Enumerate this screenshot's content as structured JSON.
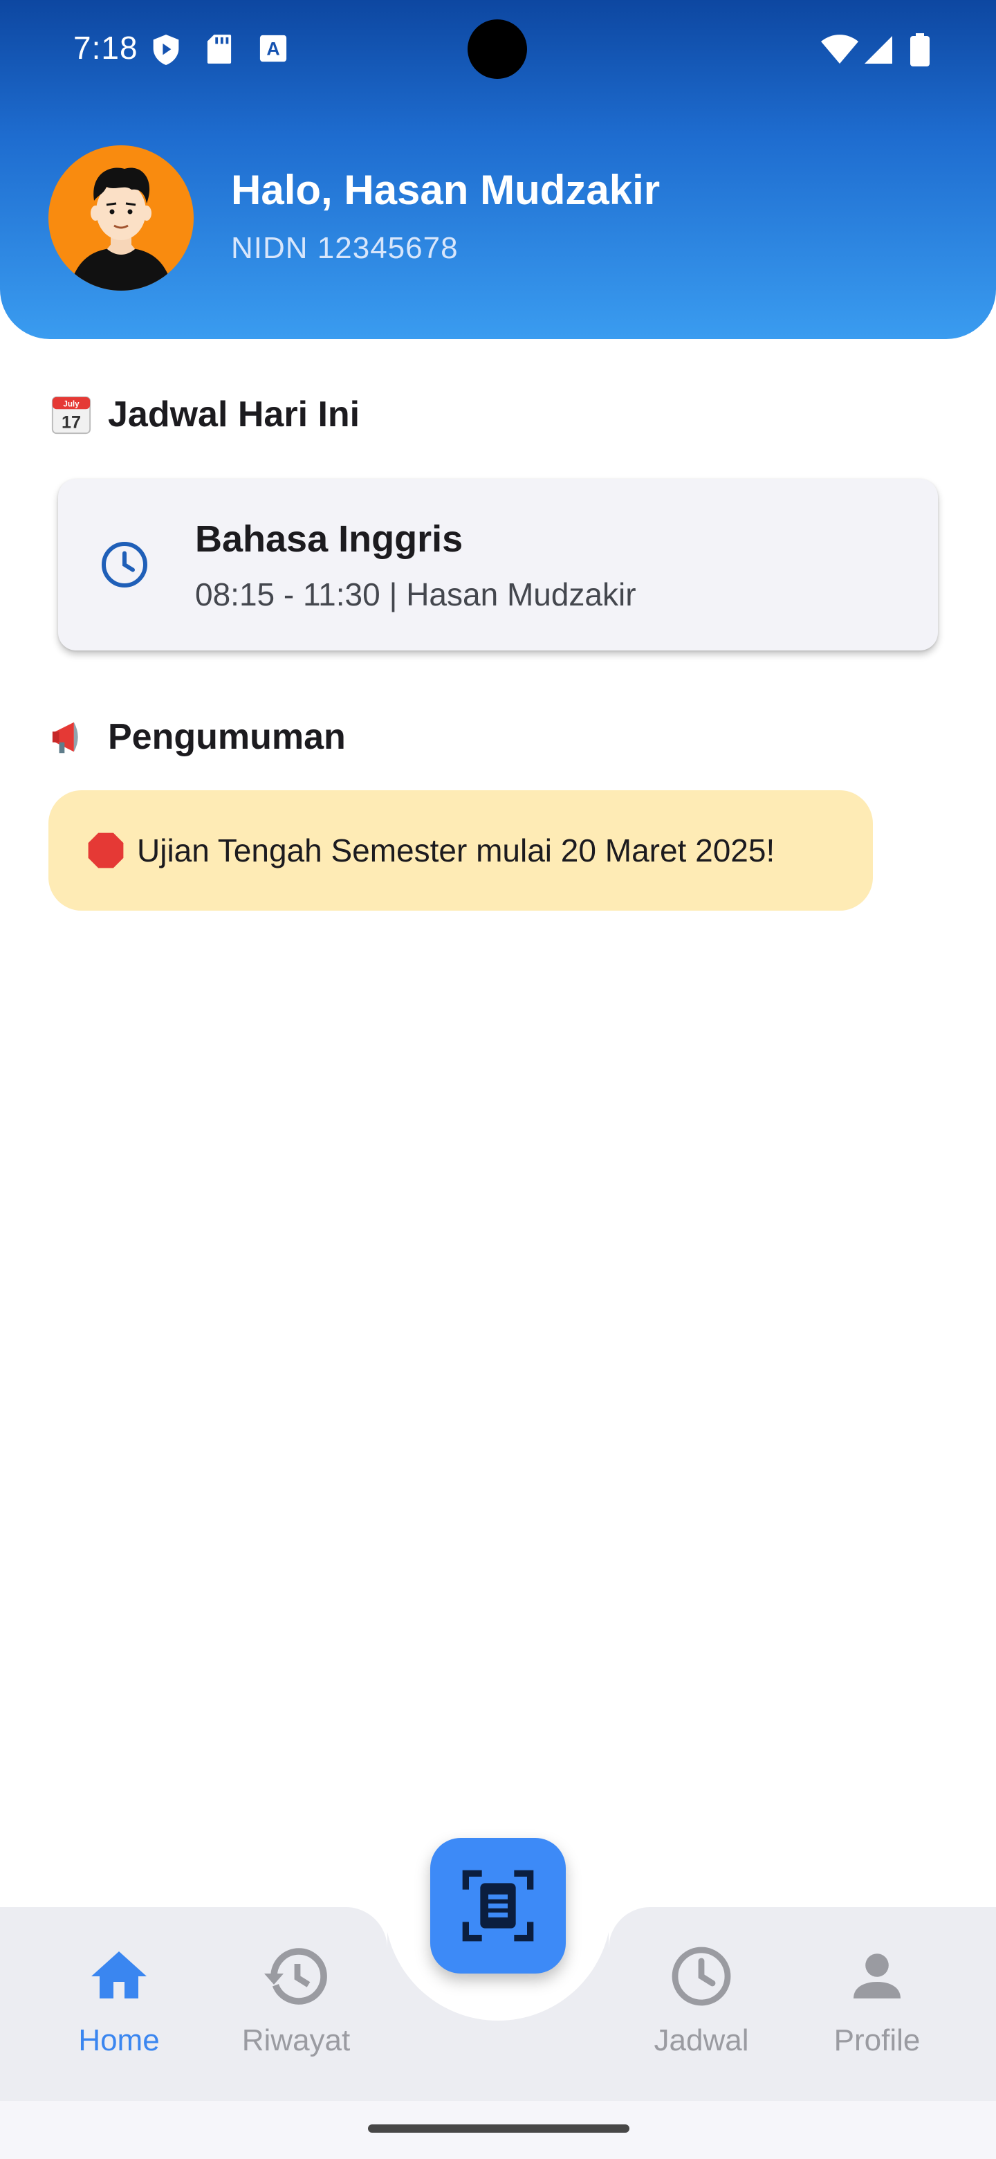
{
  "status_bar": {
    "time": "7:18"
  },
  "profile": {
    "greeting": "Halo, Hasan Mudzakir",
    "nidn": "NIDN 12345678"
  },
  "schedule": {
    "section_title": "Jadwal Hari Ini",
    "section_icon": "calendar-emoji",
    "items": [
      {
        "title": "Bahasa Inggris",
        "subtitle": "08:15 - 11:30 | Hasan Mudzakir",
        "icon": "clock-icon"
      }
    ]
  },
  "announcements": {
    "section_title": "Pengumuman",
    "section_icon": "megaphone-emoji",
    "items": [
      {
        "text": "Ujian Tengah Semester mulai 20 Maret 2025!",
        "icon": "stop-sign-emoji"
      }
    ]
  },
  "bottom_nav": {
    "items": [
      {
        "label": "Home",
        "icon": "home-icon",
        "active": true
      },
      {
        "label": "Riwayat",
        "icon": "history-icon",
        "active": false
      },
      {
        "label": "Jadwal",
        "icon": "clock-icon",
        "active": false
      },
      {
        "label": "Profile",
        "icon": "person-icon",
        "active": false
      }
    ],
    "fab_icon": "document-scan-icon"
  },
  "colors": {
    "header_gradient_top": "#0d47a1",
    "header_gradient_bottom": "#3a9cf0",
    "accent": "#3a86f0",
    "fab": "#3d8af7",
    "announcement_bg": "#feebb5",
    "avatar_bg": "#f98b0f"
  }
}
